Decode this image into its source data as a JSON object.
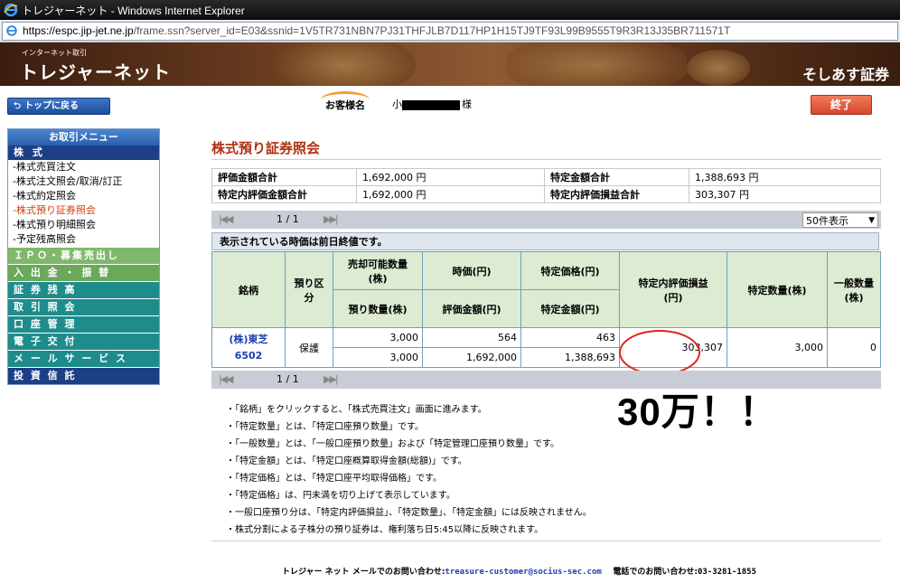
{
  "window": {
    "title": "トレジャーネット - Windows Internet Explorer",
    "url_host": "https://espc.jip-jet.ne.jp",
    "url_rest": "/frame.ssn?server_id=E03&ssnid=1V5TR731NBN7PJ31THFJLB7D117HP1H15TJ9TF93L99B9555T9R3R13J35BR711571T"
  },
  "banner": {
    "small_text": "インターネット取引",
    "logo": "トレジャーネット",
    "brand": "そしあす証券"
  },
  "header": {
    "top_button": "トップに戻る",
    "customer_label": "お客様名",
    "customer_name_prefix": "小",
    "customer_suffix": "様",
    "end_button": "終了"
  },
  "menu": {
    "title": "お取引メニュー",
    "section": "株 式",
    "items": [
      "-株式売買注文",
      "-株式注文照会/取消/訂正",
      "-株式約定照会",
      "-株式預り証券照会",
      "-株式預り明細照会",
      "-予定残高照会"
    ],
    "categories": [
      {
        "label": "ＩＰＯ・募集売出し",
        "color": "#7fb86a"
      },
      {
        "label": "入 出 金 ・ 振 替",
        "color": "#6aa85a"
      },
      {
        "label": "証 券 残 高",
        "color": "#1f8c8c"
      },
      {
        "label": "取 引 照 会",
        "color": "#1f8c8c"
      },
      {
        "label": "口 座 管 理",
        "color": "#1f8c8c"
      },
      {
        "label": "電 子 交 付",
        "color": "#1f8c8c"
      },
      {
        "label": "メ ー ル サ ー ビ ス",
        "color": "#1f8c8c"
      },
      {
        "label": "投 資 信 託",
        "color": "#1c3f86"
      }
    ]
  },
  "page": {
    "title": "株式預り証券照会",
    "summary": [
      [
        "評価金額合計",
        "1,692,000 円",
        "特定金額合計",
        "1,388,693 円"
      ],
      [
        "特定内評価金額合計",
        "1,692,000 円",
        "特定内評価損益合計",
        "303,307 円"
      ]
    ],
    "pager": {
      "first": "|◀◀",
      "page": "1 / 1",
      "last": "▶▶|"
    },
    "per_page": "50件表示",
    "notice": "表示されている時価は前日終値です。"
  },
  "holdings": {
    "headers": {
      "stock": "銘柄",
      "deposit_type": "預り区分",
      "sellable_qty": "売却可能数量(株)",
      "market_price": "時価(円)",
      "specific_price": "特定価格(円)",
      "pl": "特定内評価損益(円)",
      "specific_qty": "特定数量(株)",
      "general_qty": "一般数量(株)",
      "deposit_qty": "預り数量(株)",
      "eval_amount": "評価金額(円)",
      "specific_amount": "特定金額(円)"
    },
    "rows": [
      {
        "name": "(株)東芝",
        "code": "6502",
        "deposit_type": "保護",
        "sellable_qty": "3,000",
        "market_price": "564",
        "specific_price": "463",
        "pl": "303,307",
        "specific_qty": "3,000",
        "general_qty": "0",
        "deposit_qty": "3,000",
        "eval_amount": "1,692,000",
        "specific_amount": "1,388,693"
      }
    ]
  },
  "annotation": "30万！！",
  "notes": [
    "・「銘柄」をクリックすると、「株式売買注文」画面に進みます。",
    "・「特定数量」とは、「特定口座預り数量」です。",
    "・「一般数量」とは、「一般口座預り数量」および「特定管理口座預り数量」です。",
    "・「特定金額」とは、「特定口座概算取得金額(総額)」です。",
    "・「特定価格」とは、「特定口座平均取得価格」です。",
    "・「特定価格」は、円未満を切り上げて表示しています。",
    "・一般口座預り分は、「特定内評価損益」、「特定数量」、「特定金額」には反映されません。",
    "・株式分割による子株分の預り証券は、権利落ち日5:45以降に反映されます。"
  ],
  "footer": {
    "mail_label": "トレジャー ネット メールでのお問い合わせ:",
    "mail": "treasure-customer@socius-sec.com",
    "phone_label": "電話でのお問い合わせ:",
    "phone": "03-3281-1855"
  }
}
